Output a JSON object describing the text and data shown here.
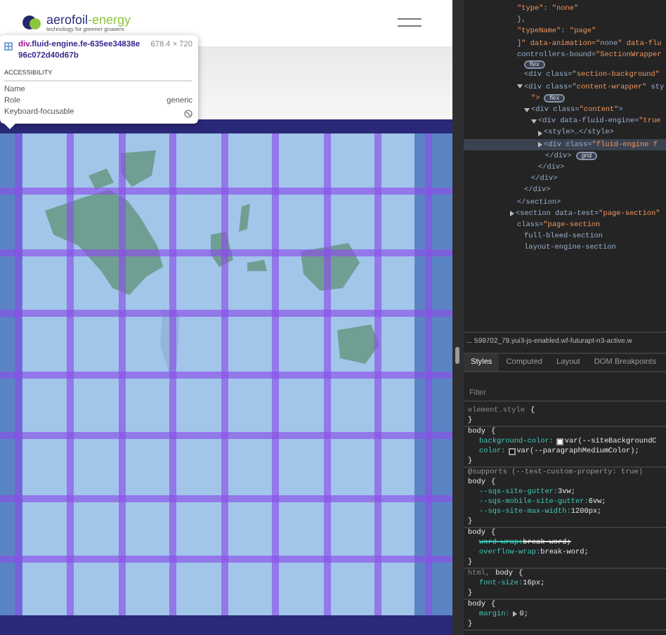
{
  "page": {
    "logo": {
      "name": "aerofoil",
      "accent": "-energy",
      "tagline": "technology for greener growers"
    },
    "inspect_tooltip": {
      "tag": "div",
      "classes": ".fluid-engine.fe-635ee34838e96c072d40d67b",
      "size": "678.4 × 720",
      "section": "ACCESSIBILITY",
      "rows": [
        {
          "label": "Name"
        },
        {
          "label": "Role",
          "value": "generic"
        },
        {
          "label": "Keyboard-focusable",
          "focusable": false
        }
      ]
    }
  },
  "devtools": {
    "elements": [
      {
        "text": "\"type\": \"none\"",
        "selected": false
      },
      {
        "text": "},",
        "selected": false
      },
      {
        "text": "\"typeName\": \"page\"",
        "selected": false
      },
      {
        "text": "]\" data-animation=\"none\" data-flu",
        "selected": false
      },
      {
        "text": "controllers-bound=\"SectionWrapper",
        "selected": false,
        "children": [
          {
            "badge": "flex",
            "selected": false
          },
          {
            "text": "<div class=\"section-background\"",
            "selected": false
          },
          {
            "text": "<div class=\"content-wrapper\" sty",
            "expanded": true,
            "selected": false,
            "children": [
              {
                "text": "\">",
                "badge": "flex",
                "selected": false
              },
              {
                "text": "<div class=\"content\">",
                "expanded": true,
                "selected": false,
                "children": [
                  {
                    "text": "<div data-fluid-engine=\"true",
                    "expanded": true,
                    "selected": false,
                    "children": [
                      {
                        "text": "<style>…</style>",
                        "expanded": false,
                        "selected": false
                      },
                      {
                        "text": "<div class=\"fluid-engine f",
                        "expanded": false,
                        "selected": true
                      },
                      {
                        "text": "</div>",
                        "badge": "grid",
                        "selected": false
                      }
                    ]
                  },
                  {
                    "text": "</div>",
                    "selected": false
                  }
                ]
              },
              {
                "text": "</div>",
                "selected": false
              }
            ]
          },
          {
            "text": "</div>",
            "selected": false
          }
        ]
      },
      {
        "text": "</section>",
        "selected": false
      },
      {
        "text": "<section data-test=\"page-section\"",
        "expanded": false,
        "selected": false
      },
      {
        "text": "class=\"page-section",
        "selected": false,
        "children": [
          {
            "text": "full-bleed-section",
            "selected": false
          },
          {
            "text": "layout-engine-section",
            "selected": false
          }
        ]
      }
    ],
    "breadcrumb": "... 599702_79.yui3-js-enabled.wf-futurapt-n3-active.w",
    "tabs": [
      {
        "label": "Styles",
        "selected": true
      },
      {
        "label": "Computed",
        "selected": false
      },
      {
        "label": "Layout",
        "selected": false
      },
      {
        "label": "DOM Breakpoints",
        "selected": false
      }
    ],
    "filter": {
      "placeholder": "Filter"
    },
    "rules": [
      {
        "selectors": [
          {
            "text": "element.style",
            "matched": false
          }
        ],
        "open": "{",
        "close": "}"
      },
      {
        "selectors": [
          {
            "text": "body",
            "matched": true
          }
        ],
        "open": "{",
        "close": "}",
        "properties": [
          {
            "name": "background-color:",
            "value": "var(--siteBackgroundC",
            "color": "#ffffff",
            "overridden": false
          },
          {
            "name": "color:",
            "value": "var(--paragraphMediumColor);",
            "color": "#111111",
            "overridden": false
          }
        ]
      },
      {
        "at_rule": "@supports (--test-custom-property: true)",
        "selectors": [
          {
            "text": "body",
            "matched": true
          }
        ],
        "open": "{",
        "close": "}",
        "properties": [
          {
            "name": "--sqs-site-gutter:",
            "value": "3vw;",
            "overridden": false
          },
          {
            "name": "--sqs-mobile-site-gutter:",
            "value": "6vw;",
            "overridden": false
          },
          {
            "name": "--sqs-site-max-width:",
            "value": "1200px;",
            "overridden": false
          }
        ]
      },
      {
        "selectors": [
          {
            "text": "body",
            "matched": true
          }
        ],
        "open": "{",
        "close": "}",
        "properties": [
          {
            "name": "word-wrap:",
            "value": "break-word;",
            "overridden": true
          },
          {
            "name": "overflow-wrap:",
            "value": "break-word;",
            "overridden": false
          }
        ]
      },
      {
        "selectors": [
          {
            "text": "html,",
            "matched": false
          },
          {
            "text": "body",
            "matched": true
          }
        ],
        "open": "{",
        "close": "}",
        "properties": [
          {
            "name": "font-size:",
            "value": "16px;",
            "overridden": false
          }
        ]
      },
      {
        "selectors": [
          {
            "text": "body",
            "matched": true
          }
        ],
        "open": "{",
        "close": "}",
        "properties": [
          {
            "name": "margin:",
            "value": "0;",
            "overridden": false,
            "expandable": true
          }
        ]
      }
    ]
  }
}
